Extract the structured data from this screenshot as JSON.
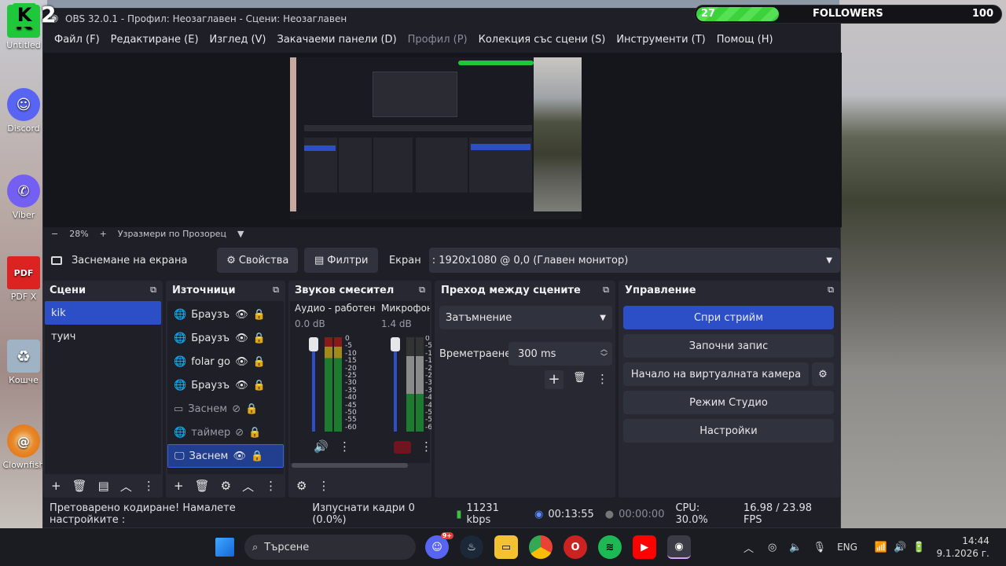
{
  "desktop": {
    "icons": [
      {
        "label": "Untitled",
        "name": "untitled-icon"
      },
      {
        "label": "Discord",
        "name": "discord-icon"
      },
      {
        "label": "Viber",
        "name": "viber-icon"
      },
      {
        "label": "PDF X",
        "name": "pdf-icon"
      },
      {
        "label": "Кошче",
        "name": "recycle-bin-icon"
      },
      {
        "label": "Clownfish",
        "name": "clownfish-icon"
      }
    ]
  },
  "overlay": {
    "followers_current": "27",
    "followers_label": "FOLLOWERS",
    "followers_goal": "100",
    "progress": 0.27,
    "logo_text": "2"
  },
  "window": {
    "title": "OBS 32.0.1 - Профил: Неозаглавен - Сцени: Неозаглавен",
    "menu": [
      {
        "label": "Файл (F)",
        "enabled": true
      },
      {
        "label": "Редактиране (E)",
        "enabled": true
      },
      {
        "label": "Изглед (V)",
        "enabled": true
      },
      {
        "label": "Закачаеми панели (D)",
        "enabled": true
      },
      {
        "label": "Профил (P)",
        "enabled": false
      },
      {
        "label": "Колекция със сцени (S)",
        "enabled": true
      },
      {
        "label": "Инструменти (T)",
        "enabled": true
      },
      {
        "label": "Помощ (H)",
        "enabled": true
      }
    ]
  },
  "zoombar": {
    "minus": "−",
    "zoom": "28%",
    "plus": "+",
    "fit": "Узразмери по Прозорец",
    "fit_display": "Узразмери по Прозорец"
  },
  "sourcebar": {
    "source_name": "Заснемане на екрана",
    "properties": "Свойства",
    "filters": "Филтри",
    "screen_label": "Екран",
    "screen_value": ": 1920x1080 @ 0,0 (Главен монитор)"
  },
  "scenes": {
    "title": "Сцени",
    "items": [
      "kik",
      "туич"
    ]
  },
  "sources": {
    "title": "Източници",
    "items": [
      {
        "label": "Браузър",
        "icon": "globe-icon",
        "visible": true
      },
      {
        "label": "Браузър",
        "icon": "globe-icon",
        "visible": true
      },
      {
        "label": "folar go",
        "icon": "globe-icon",
        "visible": true
      },
      {
        "label": "Браузър",
        "icon": "globe-icon",
        "visible": true
      },
      {
        "label": "Заснем",
        "icon": "window-icon",
        "visible": false
      },
      {
        "label": "таймер",
        "icon": "globe-icon",
        "visible": false
      },
      {
        "label": "Заснем",
        "icon": "monitor-icon",
        "visible": true
      }
    ]
  },
  "mixer": {
    "title": "Звуков смесител",
    "channels": [
      {
        "name": "Аудио - работен пл",
        "db": "0.0 dB"
      },
      {
        "name": "Микрофон/А",
        "db": "1.4 dB"
      }
    ],
    "scale": [
      "0",
      "-5",
      "-10",
      "-15",
      "-20",
      "-25",
      "-30",
      "-35",
      "-40",
      "-45",
      "-50",
      "-55",
      "-60"
    ]
  },
  "transitions": {
    "title": "Преход между сцените",
    "type": "Затъмнение",
    "duration_label": "Времетраене",
    "duration_value": "300 ms"
  },
  "controls": {
    "title": "Управление",
    "stop_stream": "Спри стрийм",
    "start_record": "Започни запис",
    "virtual_cam": "Начало на виртуалната камера",
    "studio_mode": "Режим Студио",
    "settings": "Настройки"
  },
  "status": {
    "warning": "Претоварено кодиране! Намалете настройките :",
    "dropped": "Изпуснати кадри 0 (0.0%)",
    "bitrate": "11231 kbps",
    "stream_time": "00:13:55",
    "record_time": "00:00:00",
    "cpu": "CPU: 30.0%",
    "fps": "16.98 / 23.98 FPS"
  },
  "taskbar": {
    "search_placeholder": "Търсене",
    "lang": "ENG",
    "time": "14:44",
    "date": "9.1.2026 г.",
    "discord_badge": "9+"
  }
}
